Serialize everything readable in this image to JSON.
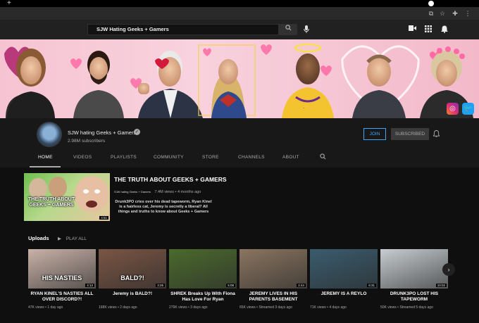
{
  "browser": {
    "new_tab": "+"
  },
  "masthead": {
    "search_value": "SJW Hating Geeks + Gamers"
  },
  "channel": {
    "name": "SJW hating Geeks + Gamers",
    "subscribers": "2.98M subscribers",
    "join_label": "JOIN",
    "subscribed_label": "SUBSCRIBED"
  },
  "tabs": [
    "HOME",
    "VIDEOS",
    "PLAYLISTS",
    "COMMUNITY",
    "STORE",
    "CHANNELS",
    "ABOUT"
  ],
  "featured": {
    "title": "THE TRUTH ABOUT GEEKS + GAMERS",
    "thumb_text": "THE TRUTH ABOUT GEEKS + GAMERS",
    "channel": "SJW hating Geeks + Gamers",
    "views": "7.4M views",
    "age": "4 months ago",
    "description": "Drunk3PO cries over his dead tapeworm, Ryan Kinel is a hairless cat, Jeremy is secretly a liberal? All things and truths to know about Geeks + Gamers",
    "duration": "4:51"
  },
  "uploads": {
    "label": "Uploads",
    "play_all": "PLAY ALL",
    "videos": [
      {
        "title": "RYAN KINEL'S NASTIES ALL OVER DISCORD?!",
        "thumb_text": "HIS NASTIES",
        "meta": "47K views • 1 day ago",
        "duration": "4:12",
        "color": "#c9b2a8"
      },
      {
        "title": "Jeremy is BALD?!",
        "thumb_text": "BALD?!",
        "meta": "168K views • 2 days ago",
        "duration": "3:26",
        "color": "#7a5544"
      },
      {
        "title": "SHREK Breaks Up With Fiona Has Love For Ryan",
        "thumb_text": "",
        "meta": "279K views • 3 days ago",
        "duration": "5:08",
        "color": "#4b6a2d"
      },
      {
        "title": "JEREMY LIVES IN HIS PARENTS BASEMENT",
        "thumb_text": "",
        "meta": "65K views • Streamed 3 days ago",
        "duration": "2:44",
        "color": "#8a7560"
      },
      {
        "title": "JEREMY IS A REYLO",
        "thumb_text": "",
        "meta": "71K views • 4 days ago",
        "duration": "6:31",
        "color": "#3a5c6e"
      },
      {
        "title": "DRUNK3PO LOST HIS TAPEWORM",
        "thumb_text": "",
        "meta": "50K views • Streamed 5 days ago",
        "duration": "10:02",
        "color": "#c7cdd0"
      }
    ]
  }
}
